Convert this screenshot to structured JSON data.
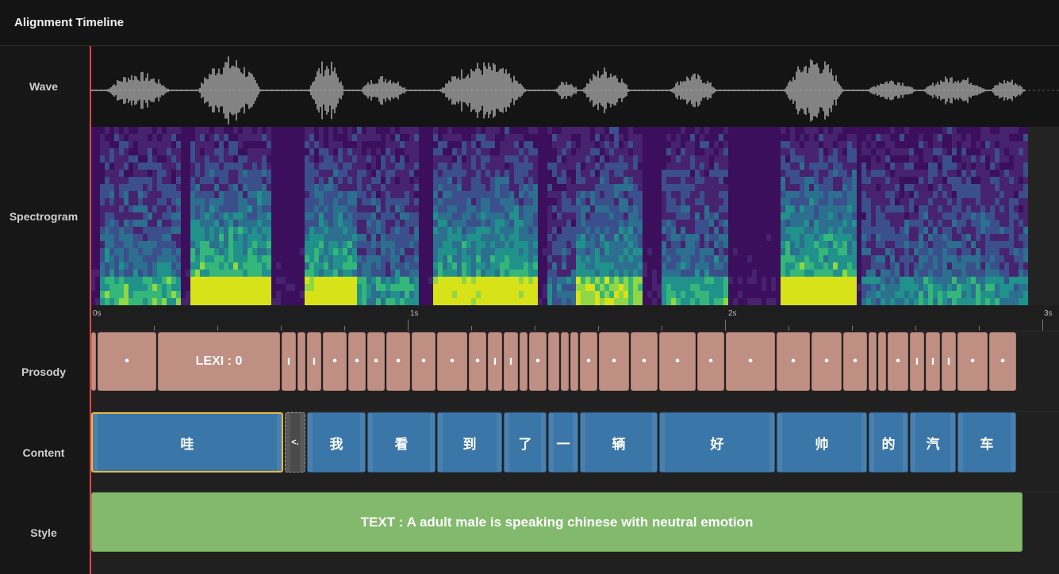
{
  "header": {
    "title": "Alignment Timeline"
  },
  "rows": {
    "wave": "Wave",
    "spectrogram": "Spectrogram",
    "prosody": "Prosody",
    "content": "Content",
    "style": "Style"
  },
  "ruler": {
    "labels": [
      "0s",
      "1s",
      "2s",
      "3s"
    ]
  },
  "prosody": {
    "segments": [
      {
        "start": 0.0,
        "end": 0.02,
        "label": ""
      },
      {
        "start": 0.02,
        "end": 0.21,
        "label": "•"
      },
      {
        "start": 0.21,
        "end": 0.6,
        "label": "LEXI : 0"
      },
      {
        "start": 0.6,
        "end": 0.65,
        "label": "ı"
      },
      {
        "start": 0.65,
        "end": 0.68,
        "label": ""
      },
      {
        "start": 0.68,
        "end": 0.73,
        "label": "ı"
      },
      {
        "start": 0.73,
        "end": 0.81,
        "label": "•"
      },
      {
        "start": 0.81,
        "end": 0.87,
        "label": "•"
      },
      {
        "start": 0.87,
        "end": 0.93,
        "label": "•"
      },
      {
        "start": 0.93,
        "end": 1.01,
        "label": "•"
      },
      {
        "start": 1.01,
        "end": 1.09,
        "label": "•"
      },
      {
        "start": 1.09,
        "end": 1.19,
        "label": "•"
      },
      {
        "start": 1.19,
        "end": 1.25,
        "label": "•"
      },
      {
        "start": 1.25,
        "end": 1.3,
        "label": "ı"
      },
      {
        "start": 1.3,
        "end": 1.35,
        "label": "ı"
      },
      {
        "start": 1.35,
        "end": 1.38,
        "label": ""
      },
      {
        "start": 1.38,
        "end": 1.44,
        "label": "•"
      },
      {
        "start": 1.44,
        "end": 1.48,
        "label": ""
      },
      {
        "start": 1.48,
        "end": 1.51,
        "label": ""
      },
      {
        "start": 1.51,
        "end": 1.54,
        "label": ""
      },
      {
        "start": 1.54,
        "end": 1.6,
        "label": "•"
      },
      {
        "start": 1.6,
        "end": 1.7,
        "label": "•"
      },
      {
        "start": 1.7,
        "end": 1.79,
        "label": "•"
      },
      {
        "start": 1.79,
        "end": 1.91,
        "label": "•"
      },
      {
        "start": 1.91,
        "end": 2.0,
        "label": "•"
      },
      {
        "start": 2.0,
        "end": 2.16,
        "label": "•"
      },
      {
        "start": 2.16,
        "end": 2.27,
        "label": "•"
      },
      {
        "start": 2.27,
        "end": 2.37,
        "label": "•"
      },
      {
        "start": 2.37,
        "end": 2.45,
        "label": "•"
      },
      {
        "start": 2.45,
        "end": 2.48,
        "label": ""
      },
      {
        "start": 2.48,
        "end": 2.51,
        "label": ""
      },
      {
        "start": 2.51,
        "end": 2.58,
        "label": "•"
      },
      {
        "start": 2.58,
        "end": 2.63,
        "label": "ı"
      },
      {
        "start": 2.63,
        "end": 2.68,
        "label": "ı"
      },
      {
        "start": 2.68,
        "end": 2.73,
        "label": "ı"
      },
      {
        "start": 2.73,
        "end": 2.83,
        "label": "•"
      },
      {
        "start": 2.83,
        "end": 2.92,
        "label": "•"
      }
    ]
  },
  "content": {
    "segments": [
      {
        "start": 0.0,
        "end": 0.61,
        "label": "哇",
        "selected": true
      },
      {
        "start": 0.61,
        "end": 0.68,
        "label": "<.",
        "ghost": true
      },
      {
        "start": 0.68,
        "end": 0.87,
        "label": "我"
      },
      {
        "start": 0.87,
        "end": 1.09,
        "label": "看"
      },
      {
        "start": 1.09,
        "end": 1.3,
        "label": "到"
      },
      {
        "start": 1.3,
        "end": 1.44,
        "label": "了"
      },
      {
        "start": 1.44,
        "end": 1.54,
        "label": "一"
      },
      {
        "start": 1.54,
        "end": 1.79,
        "label": "辆"
      },
      {
        "start": 1.79,
        "end": 2.16,
        "label": "好"
      },
      {
        "start": 2.16,
        "end": 2.45,
        "label": "帅"
      },
      {
        "start": 2.45,
        "end": 2.58,
        "label": "的"
      },
      {
        "start": 2.58,
        "end": 2.73,
        "label": "汽"
      },
      {
        "start": 2.73,
        "end": 2.92,
        "label": "车"
      }
    ]
  },
  "style": {
    "segments": [
      {
        "start": 0.0,
        "end": 2.94,
        "label": "TEXT : A adult male is speaking chinese with neutral emotion"
      }
    ]
  },
  "timeline": {
    "duration": 3.0
  },
  "colors": {
    "prosody": "#bf8f83",
    "content": "#3b76a8",
    "style": "#82b96d",
    "playhead": "#e54545",
    "selection": "#e8b840"
  }
}
